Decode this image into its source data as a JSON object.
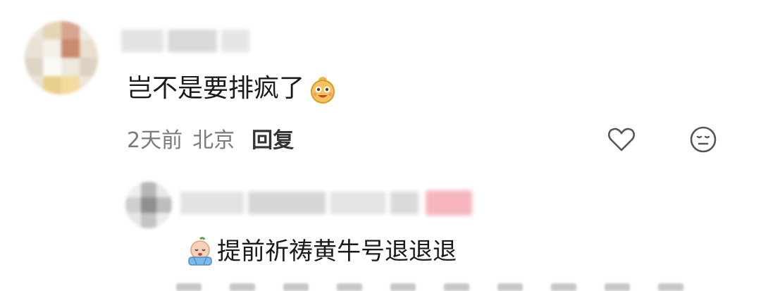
{
  "comment": {
    "author_name": "",
    "text": "岂不是要排疯了",
    "emoji_icon": "smiling-bag-emoji-icon",
    "time": "2天前",
    "location": "北京",
    "reply_label": "回复",
    "like_icon": "heart-icon",
    "react_icon": "neutral-face-icon"
  },
  "reply": {
    "author_name": "",
    "text": "提前祈祷黄牛号退退退",
    "emoji_icon": "praying-emoji-icon",
    "author_badge_color": "#f7b6bf"
  },
  "colors": {
    "text": "#1a1a1a",
    "meta": "#7a7a7a",
    "icon": "#555555"
  }
}
